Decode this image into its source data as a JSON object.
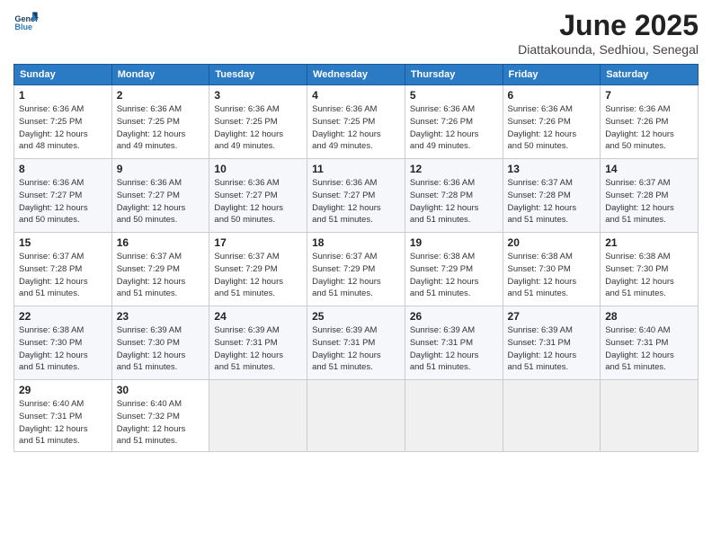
{
  "logo": {
    "line1": "General",
    "line2": "Blue"
  },
  "title": "June 2025",
  "location": "Diattakounda, Sedhiou, Senegal",
  "days_header": [
    "Sunday",
    "Monday",
    "Tuesday",
    "Wednesday",
    "Thursday",
    "Friday",
    "Saturday"
  ],
  "weeks": [
    [
      {
        "day": "1",
        "rise": "6:36 AM",
        "set": "7:25 PM",
        "hours": "12 hours",
        "mins": "48 minutes."
      },
      {
        "day": "2",
        "rise": "6:36 AM",
        "set": "7:25 PM",
        "hours": "12 hours",
        "mins": "49 minutes."
      },
      {
        "day": "3",
        "rise": "6:36 AM",
        "set": "7:25 PM",
        "hours": "12 hours",
        "mins": "49 minutes."
      },
      {
        "day": "4",
        "rise": "6:36 AM",
        "set": "7:25 PM",
        "hours": "12 hours",
        "mins": "49 minutes."
      },
      {
        "day": "5",
        "rise": "6:36 AM",
        "set": "7:26 PM",
        "hours": "12 hours",
        "mins": "49 minutes."
      },
      {
        "day": "6",
        "rise": "6:36 AM",
        "set": "7:26 PM",
        "hours": "12 hours",
        "mins": "50 minutes."
      },
      {
        "day": "7",
        "rise": "6:36 AM",
        "set": "7:26 PM",
        "hours": "12 hours",
        "mins": "50 minutes."
      }
    ],
    [
      {
        "day": "8",
        "rise": "6:36 AM",
        "set": "7:27 PM",
        "hours": "12 hours",
        "mins": "50 minutes."
      },
      {
        "day": "9",
        "rise": "6:36 AM",
        "set": "7:27 PM",
        "hours": "12 hours",
        "mins": "50 minutes."
      },
      {
        "day": "10",
        "rise": "6:36 AM",
        "set": "7:27 PM",
        "hours": "12 hours",
        "mins": "50 minutes."
      },
      {
        "day": "11",
        "rise": "6:36 AM",
        "set": "7:27 PM",
        "hours": "12 hours",
        "mins": "51 minutes."
      },
      {
        "day": "12",
        "rise": "6:36 AM",
        "set": "7:28 PM",
        "hours": "12 hours",
        "mins": "51 minutes."
      },
      {
        "day": "13",
        "rise": "6:37 AM",
        "set": "7:28 PM",
        "hours": "12 hours",
        "mins": "51 minutes."
      },
      {
        "day": "14",
        "rise": "6:37 AM",
        "set": "7:28 PM",
        "hours": "12 hours",
        "mins": "51 minutes."
      }
    ],
    [
      {
        "day": "15",
        "rise": "6:37 AM",
        "set": "7:28 PM",
        "hours": "12 hours",
        "mins": "51 minutes."
      },
      {
        "day": "16",
        "rise": "6:37 AM",
        "set": "7:29 PM",
        "hours": "12 hours",
        "mins": "51 minutes."
      },
      {
        "day": "17",
        "rise": "6:37 AM",
        "set": "7:29 PM",
        "hours": "12 hours",
        "mins": "51 minutes."
      },
      {
        "day": "18",
        "rise": "6:37 AM",
        "set": "7:29 PM",
        "hours": "12 hours",
        "mins": "51 minutes."
      },
      {
        "day": "19",
        "rise": "6:38 AM",
        "set": "7:29 PM",
        "hours": "12 hours",
        "mins": "51 minutes."
      },
      {
        "day": "20",
        "rise": "6:38 AM",
        "set": "7:30 PM",
        "hours": "12 hours",
        "mins": "51 minutes."
      },
      {
        "day": "21",
        "rise": "6:38 AM",
        "set": "7:30 PM",
        "hours": "12 hours",
        "mins": "51 minutes."
      }
    ],
    [
      {
        "day": "22",
        "rise": "6:38 AM",
        "set": "7:30 PM",
        "hours": "12 hours",
        "mins": "51 minutes."
      },
      {
        "day": "23",
        "rise": "6:39 AM",
        "set": "7:30 PM",
        "hours": "12 hours",
        "mins": "51 minutes."
      },
      {
        "day": "24",
        "rise": "6:39 AM",
        "set": "7:31 PM",
        "hours": "12 hours",
        "mins": "51 minutes."
      },
      {
        "day": "25",
        "rise": "6:39 AM",
        "set": "7:31 PM",
        "hours": "12 hours",
        "mins": "51 minutes."
      },
      {
        "day": "26",
        "rise": "6:39 AM",
        "set": "7:31 PM",
        "hours": "12 hours",
        "mins": "51 minutes."
      },
      {
        "day": "27",
        "rise": "6:39 AM",
        "set": "7:31 PM",
        "hours": "12 hours",
        "mins": "51 minutes."
      },
      {
        "day": "28",
        "rise": "6:40 AM",
        "set": "7:31 PM",
        "hours": "12 hours",
        "mins": "51 minutes."
      }
    ],
    [
      {
        "day": "29",
        "rise": "6:40 AM",
        "set": "7:31 PM",
        "hours": "12 hours",
        "mins": "51 minutes."
      },
      {
        "day": "30",
        "rise": "6:40 AM",
        "set": "7:32 PM",
        "hours": "12 hours",
        "mins": "51 minutes."
      },
      null,
      null,
      null,
      null,
      null
    ]
  ],
  "labels": {
    "sunrise": "Sunrise:",
    "sunset": "Sunset:",
    "daylight": "Daylight:"
  }
}
